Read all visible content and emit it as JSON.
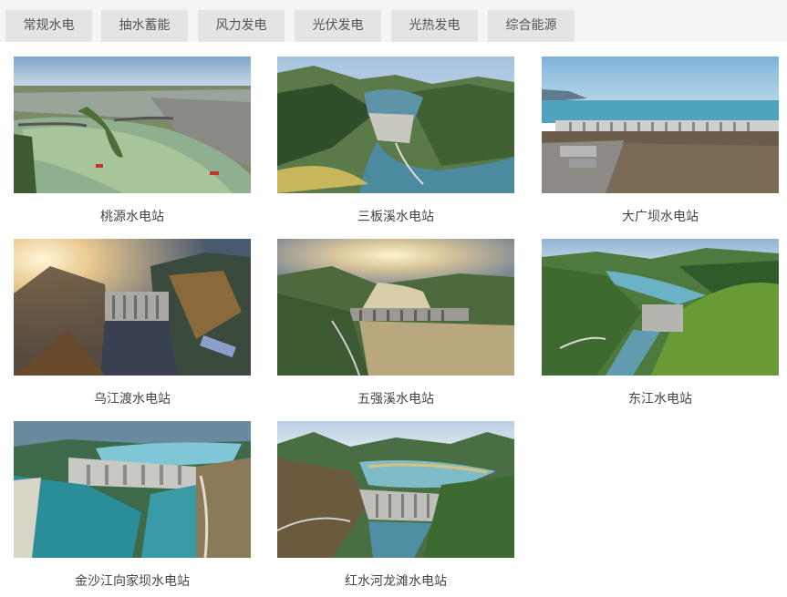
{
  "tabs": [
    {
      "label": "常规水电"
    },
    {
      "label": "抽水蓄能"
    },
    {
      "label": "风力发电"
    },
    {
      "label": "光伏发电"
    },
    {
      "label": "光热发电"
    },
    {
      "label": "综合能源"
    }
  ],
  "stations": [
    {
      "name": "桃源水电站"
    },
    {
      "name": "三板溪水电站"
    },
    {
      "name": "大广坝水电站"
    },
    {
      "name": "乌江渡水电站"
    },
    {
      "name": "五强溪水电站"
    },
    {
      "name": "东江水电站"
    },
    {
      "name": "金沙江向家坝水电站"
    },
    {
      "name": "红水河龙滩水电站"
    }
  ]
}
